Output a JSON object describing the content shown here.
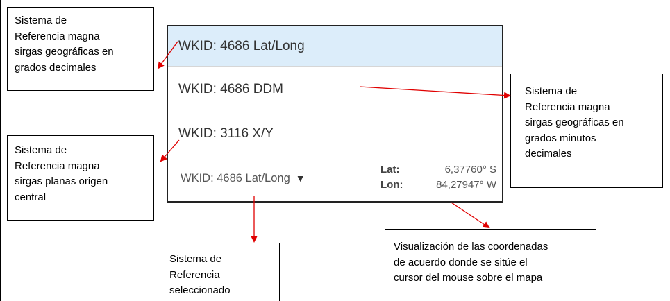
{
  "annotations": {
    "top_left": "Sistema de\nReferencia    magna\nsirgas geográficas en\ngrados decimales",
    "middle_left": "Sistema de\nReferencia    magna\nsirgas planas origen\ncentral",
    "right": "Sistema de\nReferencia magna\nsirgas geográficas en\ngrados minutos\ndecimales",
    "bottom_center": "Sistema de Referencia\nseleccionado",
    "bottom_right": "Visualización de las coordenadas\nde acuerdo donde se sitúe el\ncursor del mouse sobre el mapa"
  },
  "widget": {
    "options": [
      "WKID: 4686 Lat/Long",
      "WKID: 4686 DDM",
      "WKID: 3116 X/Y"
    ],
    "selected_option": "WKID: 4686 Lat/Long",
    "selected_label": "WKID: 4686 Lat/Long",
    "dropdown_icon": "caret-down-icon",
    "lat_label": "Lat:",
    "lat_value": "6,37760° S",
    "lon_label": "Lon:",
    "lon_value": "84,27947° W",
    "highlight_color": "#dcedfa"
  },
  "colors": {
    "arrow": "#e00000"
  }
}
